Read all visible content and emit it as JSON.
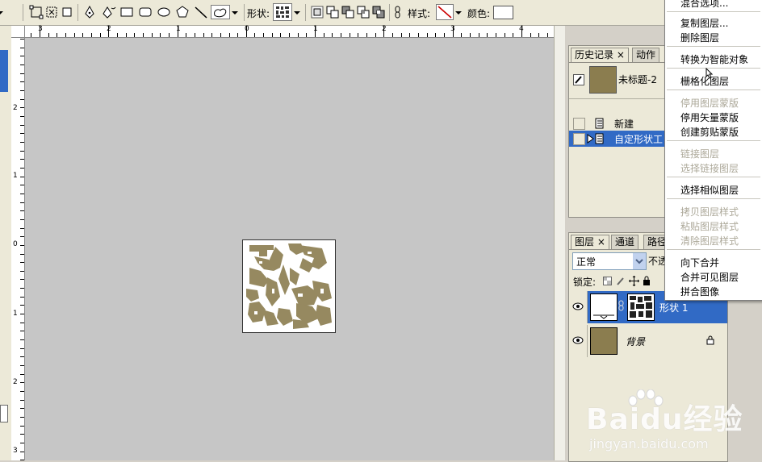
{
  "options_bar": {
    "shape_label": "形状:",
    "style_label": "样式:",
    "color_label": "颜色:",
    "colors": {
      "style_line": "#cc0000",
      "color_swatch": "#ffffff"
    }
  },
  "rulers": {
    "top_ticks": [
      "3",
      "2",
      "1",
      "0",
      "1",
      "2",
      "3",
      "4"
    ],
    "left_ticks": [
      "2",
      "1",
      "0",
      "1",
      "2",
      "3"
    ]
  },
  "history_panel": {
    "tabs": [
      "历史记录",
      "动作"
    ],
    "snapshot_name": "未标题-2",
    "snapshot_color": "#8b7d4f",
    "items": [
      {
        "label": "新建"
      },
      {
        "label": "自定形状工"
      }
    ]
  },
  "layers_panel": {
    "tabs": [
      "图层",
      "通道",
      "路径"
    ],
    "blend_mode": "正常",
    "opacity_label": "不透",
    "lock_label": "锁定:",
    "layers": [
      {
        "name": "形状 1",
        "selected": true
      },
      {
        "name": "背景",
        "locked": true,
        "color": "#8b7d4f"
      }
    ]
  },
  "context_menu": {
    "partial_top_item": "混合选项...",
    "items": [
      {
        "label": "复制图层...",
        "enabled": true
      },
      {
        "label": "删除图层",
        "enabled": true
      },
      {
        "label": "转换为智能对象",
        "enabled": true
      },
      {
        "label": "栅格化图层",
        "enabled": true
      },
      {
        "label": "停用图层蒙版",
        "enabled": false
      },
      {
        "label": "停用矢量蒙版",
        "enabled": true
      },
      {
        "label": "创建剪贴蒙版",
        "enabled": true
      },
      {
        "label": "链接图层",
        "enabled": false
      },
      {
        "label": "选择链接图层",
        "enabled": false
      },
      {
        "label": "选择相似图层",
        "enabled": true
      },
      {
        "label": "拷贝图层样式",
        "enabled": false
      },
      {
        "label": "粘贴图层样式",
        "enabled": false
      },
      {
        "label": "清除图层样式",
        "enabled": false
      },
      {
        "label": "向下合并",
        "enabled": true
      },
      {
        "label": "合并可见图层",
        "enabled": true
      },
      {
        "label": "拼合图像",
        "enabled": true
      }
    ]
  },
  "watermark": {
    "brand": "Baidu经验",
    "url": "jingyan.baidu.com"
  },
  "colors": {
    "selection_blue": "#316ac5",
    "canvas_gray": "#c6c6c6",
    "pattern_gold": "#8b7d4f"
  }
}
